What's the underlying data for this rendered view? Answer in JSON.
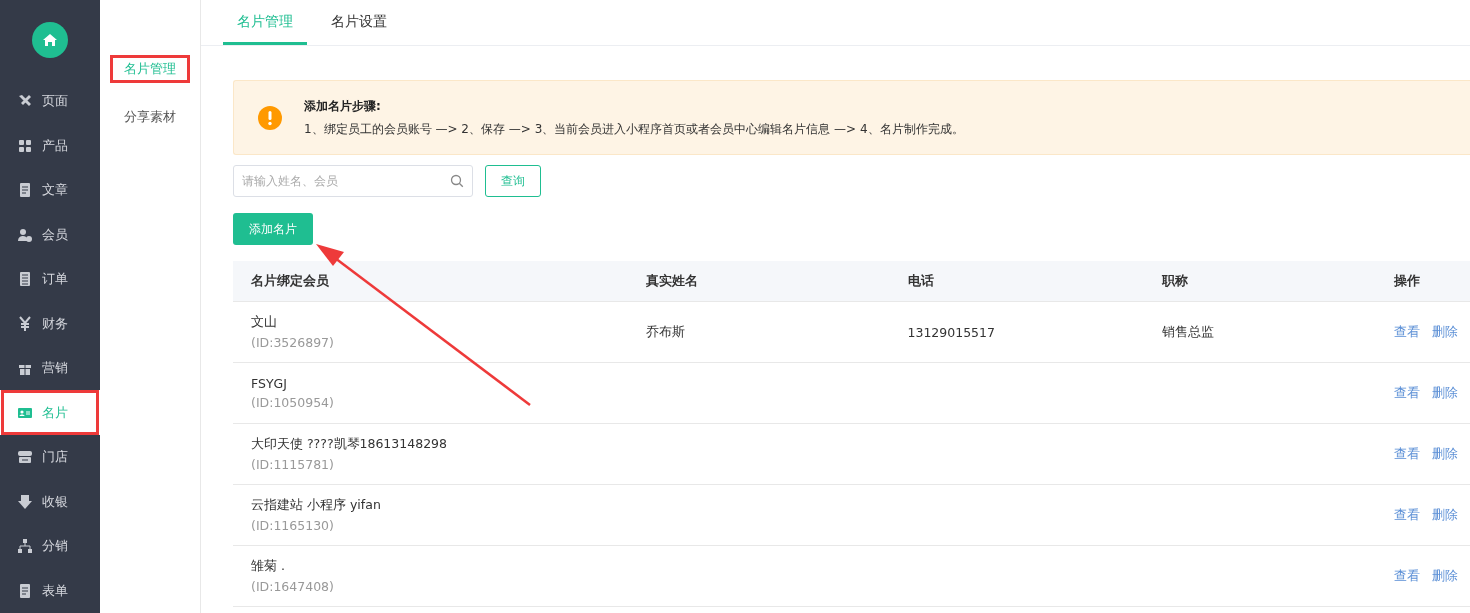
{
  "sidebar": {
    "items": [
      {
        "label": "页面",
        "selected": false,
        "highlighted": false
      },
      {
        "label": "产品",
        "selected": false,
        "highlighted": false
      },
      {
        "label": "文章",
        "selected": false,
        "highlighted": false
      },
      {
        "label": "会员",
        "selected": false,
        "highlighted": false
      },
      {
        "label": "订单",
        "selected": false,
        "highlighted": false
      },
      {
        "label": "财务",
        "selected": false,
        "highlighted": false
      },
      {
        "label": "营销",
        "selected": false,
        "highlighted": false
      },
      {
        "label": "名片",
        "selected": true,
        "highlighted": true
      },
      {
        "label": "门店",
        "selected": false,
        "highlighted": false
      },
      {
        "label": "收银",
        "selected": false,
        "highlighted": false
      },
      {
        "label": "分销",
        "selected": false,
        "highlighted": false
      },
      {
        "label": "表单",
        "selected": false,
        "highlighted": false
      }
    ]
  },
  "subnav": {
    "items": [
      {
        "label": "名片管理",
        "selected": true,
        "highlighted": true
      },
      {
        "label": "分享素材",
        "selected": false,
        "highlighted": false
      }
    ]
  },
  "tabs": [
    {
      "label": "名片管理",
      "selected": true
    },
    {
      "label": "名片设置",
      "selected": false
    }
  ],
  "notice": {
    "title": "添加名片步骤:",
    "text": "1、绑定员工的会员账号 —> 2、保存 —> 3、当前会员进入小程序首页或者会员中心编辑名片信息 —> 4、名片制作完成。"
  },
  "search": {
    "placeholder": "请输入姓名、会员"
  },
  "query_button": "查询",
  "add_button": "添加名片",
  "table": {
    "columns": [
      "名片绑定会员",
      "真实姓名",
      "电话",
      "职称",
      "操作"
    ],
    "rows": [
      {
        "member": "文山",
        "member_id": "(ID:3526897)",
        "real_name": "乔布斯",
        "phone": "13129015517",
        "title": "销售总监",
        "actions": [
          "查看",
          "删除"
        ]
      },
      {
        "member": "FSYGJ",
        "member_id": "(ID:1050954)",
        "actions": [
          "查看",
          "删除"
        ]
      },
      {
        "member": "大印天使 ????凯琴18613148298",
        "member_id": "(ID:1115781)",
        "actions": [
          "查看",
          "删除"
        ]
      },
      {
        "member": "云指建站 小程序 yifan",
        "member_id": "(ID:1165130)",
        "actions": [
          "查看",
          "删除"
        ]
      },
      {
        "member": "雏菊 .",
        "member_id": "(ID:1647408)",
        "actions": [
          "查看",
          "删除"
        ]
      }
    ]
  }
}
